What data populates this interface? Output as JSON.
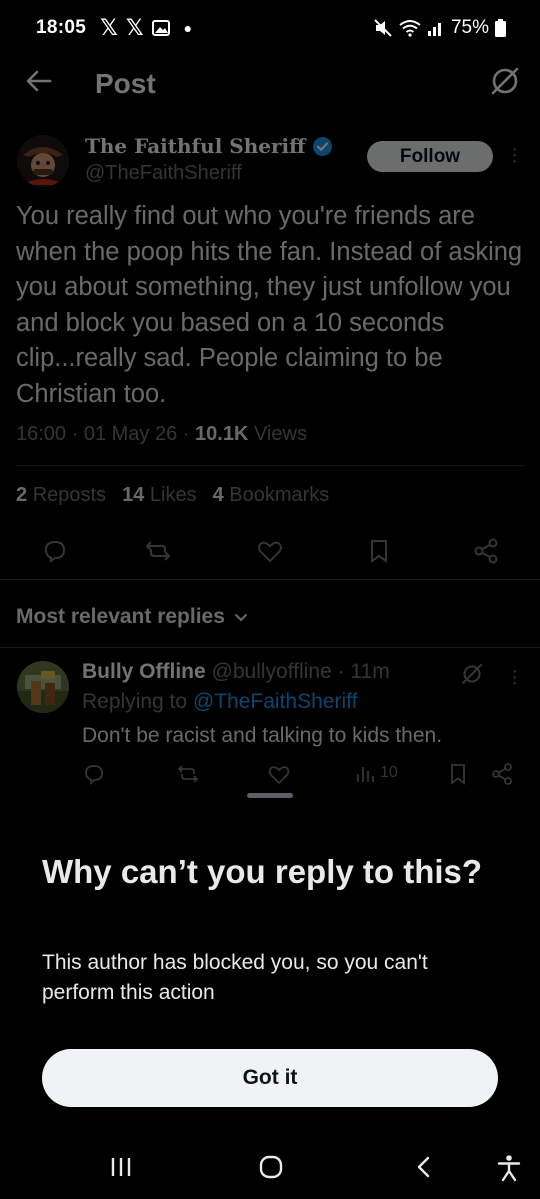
{
  "status_bar": {
    "time": "18:05",
    "battery": "75%",
    "app_icons": [
      "x-icon",
      "x-icon",
      "gallery-icon",
      "dot"
    ]
  },
  "header": {
    "title": "Post"
  },
  "post": {
    "author_name": "The Faithful Sheriff",
    "verified": true,
    "handle": "@TheFaithSheriff",
    "follow_label": "Follow",
    "text": "You really find out who you're friends are when the poop hits the fan. Instead of asking you about something, they just unfollow you and block you based on a 10 seconds clip...really sad. People claiming to be Christian too.",
    "time": "16:00",
    "date": "01 May 26",
    "views_count": "10.1K",
    "views_label": "Views",
    "reposts_count": "2",
    "reposts_label": "Reposts",
    "likes_count": "14",
    "likes_label": "Likes",
    "bookmarks_count": "4",
    "bookmarks_label": "Bookmarks"
  },
  "replies_filter": {
    "label": "Most relevant replies"
  },
  "reply": {
    "author_name": "Bully Offline",
    "handle": "@bullyoffline",
    "separator": "·",
    "age": "11m",
    "replying_prefix": "Replying to",
    "replying_to": "@TheFaithSheriff",
    "text": "Don't be racist and talking to kids then.",
    "views_count": "10"
  },
  "sheet": {
    "title": "Why can’t you reply to this?",
    "body": "This author has blocked you, so you can't perform this action",
    "button_label": "Got it"
  },
  "colors": {
    "background": "#000000",
    "accent_blue": "#1d9bf0",
    "muted_text": "#71767b",
    "button_bg": "#eff3f4"
  }
}
